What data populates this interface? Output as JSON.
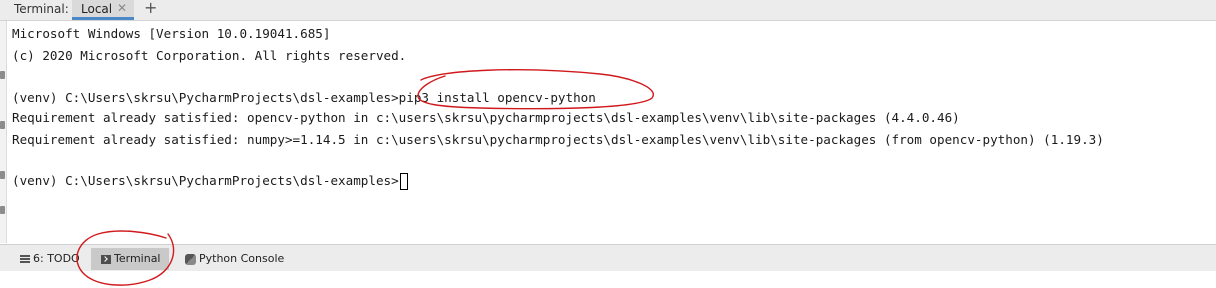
{
  "tabbar": {
    "title": "Terminal:",
    "tab_label": "Local",
    "close_glyph": "✕",
    "add_glyph": "+"
  },
  "terminal": {
    "lines": [
      "Microsoft Windows [Version 10.0.19041.685]",
      "(c) 2020 Microsoft Corporation. All rights reserved.",
      "",
      "(venv) C:\\Users\\skrsu\\PycharmProjects\\dsl-examples>pip3 install opencv-python",
      "Requirement already satisfied: opencv-python in c:\\users\\skrsu\\pycharmprojects\\dsl-examples\\venv\\lib\\site-packages (4.4.0.46)",
      "Requirement already satisfied: numpy>=1.14.5 in c:\\users\\skrsu\\pycharmprojects\\dsl-examples\\venv\\lib\\site-packages (from opencv-python) (1.19.3)",
      "",
      "(venv) C:\\Users\\skrsu\\PycharmProjects\\dsl-examples>"
    ]
  },
  "bottombar": {
    "todo_label": "6: TODO",
    "terminal_label": "Terminal",
    "python_console_label": "Python Console"
  },
  "annotation_color": "#d0191c",
  "icons": {
    "todo": "list-icon",
    "terminal": "terminal-icon",
    "python_console": "python-icon"
  }
}
